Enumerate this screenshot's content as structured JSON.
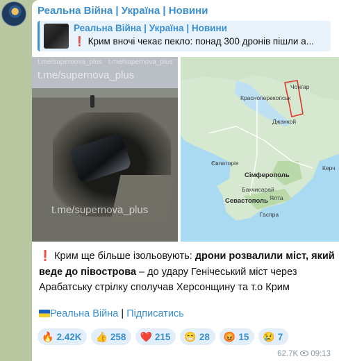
{
  "post": {
    "channel_name": "Реальна Війна | Україна | Новини",
    "forwarded": {
      "title": "Реальна Війна | Україна | Новини",
      "preview": "Крим вночі чекає пекло: понад 300 дронів пішли а..."
    },
    "photo": {
      "watermarks": [
        "t.me/supernova_plus",
        "t.me/supernova_plus",
        "t.me/supernova_plus",
        "t.me/supernova_plus"
      ]
    },
    "map": {
      "cities": [
        "Чонгар",
        "Красноперекопськ",
        "Джанкой",
        "Євпаторія",
        "Сімферополь",
        "Керч",
        "Бахчисарай",
        "Севастополь",
        "Ялта",
        "Гаспра"
      ],
      "highlight_color": "#e2352f"
    },
    "text": {
      "part1": "Крим ще більше ізольовують: ",
      "part2_bold": "дрони розвалили міст, який веде до півострова",
      "part3": " – до удару Генічеський міст через Арабатську стрілку сполучав Херсонщину та т.о Крим"
    },
    "links": {
      "channel": "Реальна Війна",
      "separator": "|",
      "subscribe": "Підписатись"
    },
    "reactions": [
      {
        "emoji": "🔥",
        "icon": "fire-icon",
        "count": "2.42K"
      },
      {
        "emoji": "👍",
        "icon": "thumbs-up-icon",
        "count": "258"
      },
      {
        "emoji": "❤️",
        "icon": "heart-icon",
        "count": "215"
      },
      {
        "emoji": "😁",
        "icon": "grin-icon",
        "count": "28"
      },
      {
        "emoji": "😡",
        "icon": "angry-icon",
        "count": "15"
      },
      {
        "emoji": "😢",
        "icon": "cry-icon",
        "count": "7"
      }
    ],
    "views": "62.7K",
    "time": "09:13"
  },
  "colors": {
    "accent": "#3a8fd1",
    "background": "#b8c7a0",
    "bubble": "#ffffff"
  }
}
